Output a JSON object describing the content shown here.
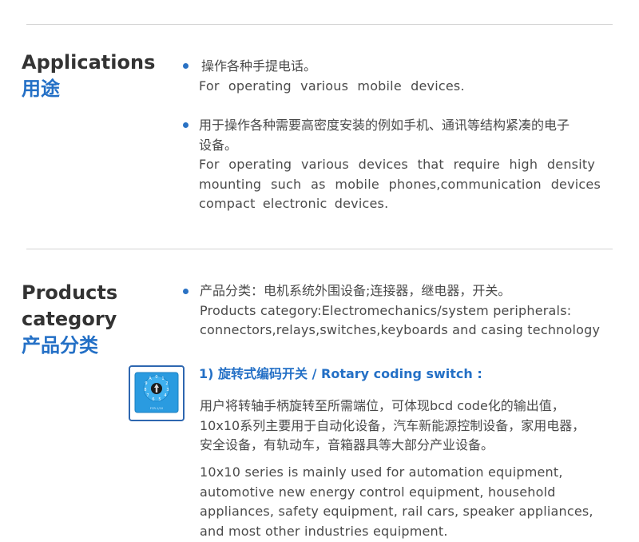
{
  "applications": {
    "heading_en": "Applications",
    "heading_cn": "用途",
    "items": [
      {
        "cn_lines": [
          "操作各种手提电话。"
        ],
        "en_lines": [
          "For operating various mobile devices."
        ]
      },
      {
        "cn_lines": [
          "用于操作各种需要高密度安装的例如手机、通讯等结构紧凑的电子",
          "设备。"
        ],
        "en_lines": [
          "For operating various devices that require high density",
          "mounting such as mobile phones,communication devices",
          "compact electronic devices."
        ]
      }
    ]
  },
  "products": {
    "heading_en_1": "Products",
    "heading_en_2": "category",
    "heading_cn": "产品分类",
    "intro_cn": "产品分类：电机系统外围设备;连接器，继电器，开关。",
    "intro_en_lines": [
      "Products category:Electromechanics/system peripherals:",
      "connectors,relays,switches,keyboards and casing technology"
    ],
    "switch": {
      "title": "1) 旋转式编码开关 /  Rotary coding switch :",
      "cn_lines": [
        "用户将转轴手柄旋转至所需端位，可体现bcd code化的输出值，",
        "10x10系列主要用于自动化设备，汽车新能源控制设备，家用电器，",
        "安全设备，有轨动车，音箱器具等大部分产业设备。"
      ],
      "en_lines": [
        "10x10 series is mainly used for automation equipment,",
        "automotive new energy control equipment, household",
        "appliances, safety equipment, rail cars, speaker appliances,",
        "and most other industries equipment."
      ],
      "image_label": "FCR-1/10"
    }
  },
  "colors": {
    "accent": "#2470c6",
    "text": "#4a4a4a",
    "heading": "#333333",
    "rule": "#d4d4d4"
  },
  "icons": {
    "bullet": "bullet-dot-icon",
    "switch_image": "rotary-switch-image"
  }
}
